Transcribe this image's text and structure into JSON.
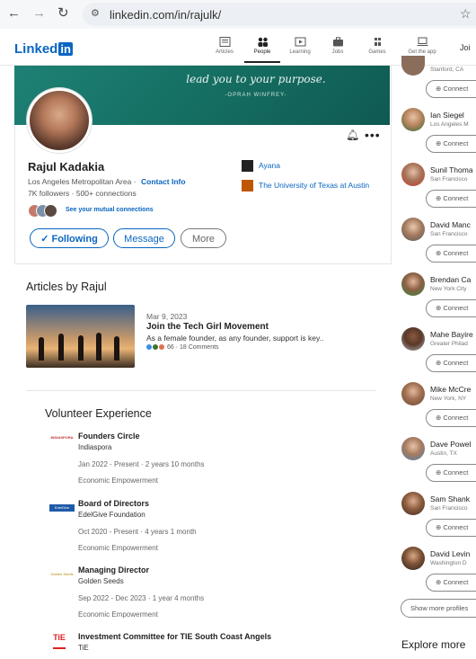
{
  "browser": {
    "url": "linkedin.com/in/rajulk/"
  },
  "nav": {
    "logo": "Linked",
    "logo_box": "in",
    "items": [
      {
        "label": "Articles",
        "icon": "articles-icon"
      },
      {
        "label": "People",
        "icon": "people-icon"
      },
      {
        "label": "Learning",
        "icon": "learning-icon"
      },
      {
        "label": "Jobs",
        "icon": "jobs-icon"
      },
      {
        "label": "Games",
        "icon": "games-icon"
      },
      {
        "label": "Get the app",
        "icon": "get-app-icon"
      }
    ],
    "join": "Joi"
  },
  "profile": {
    "banner_quote": "lead you to your purpose.",
    "banner_author": "-OPRAH WINFREY-",
    "name": "Rajul Kadakia",
    "location": "Los Angeles Metropolitan Area",
    "separator": "·",
    "contact_info": "Contact Info",
    "stats": "7K followers  ·  500+ connections",
    "mutual": "See your mutual connections",
    "follow": "✓ Following",
    "message": "Message",
    "more": "More",
    "experience": [
      {
        "name": "Ayana"
      },
      {
        "name": "The University of Texas at Austin"
      }
    ]
  },
  "articles": {
    "title": "Articles by Rajul",
    "date": "Mar 9, 2023",
    "headline": "Join the Tech Girl Movement",
    "excerpt": "As a female founder, as any founder, support is key..",
    "reactions": "66 · 18 Comments"
  },
  "volunteer": {
    "title": "Volunteer Experience",
    "items": [
      {
        "role": "Founders Circle",
        "org": "Indiaspora",
        "dates": "Jan 2022 - Present · 2 years 10 months",
        "cause": "Economic Empowerment",
        "logo_text": "INDIASPORA"
      },
      {
        "role": "Board of Directors",
        "org": "EdelGive Foundation",
        "dates": "Oct 2020 - Present · 4 years 1 month",
        "cause": "Economic Empowerment",
        "logo_text": "EdelGive"
      },
      {
        "role": "Managing Director",
        "org": "Golden Seeds",
        "dates": "Sep 2022 - Dec 2023 · 1 year 4 months",
        "cause": "Economic Empowerment",
        "logo_text": "Golden Seeds"
      },
      {
        "role": "Investment Committee for TIE South Coast Angels",
        "org": "TiE",
        "dates": "",
        "cause": "",
        "logo_text": "TiE"
      }
    ]
  },
  "sidebar": {
    "top_location": "Stanford, CA",
    "connect_label": "Connect",
    "people": [
      {
        "name": "Ian Siegel",
        "location": "Los Angeles M"
      },
      {
        "name": "Sunil Thoma",
        "location": "San Francisco"
      },
      {
        "name": "David Manc",
        "location": "San Francisco"
      },
      {
        "name": "Brendan Ca",
        "location": "New York City"
      },
      {
        "name": "Mahe Bayire",
        "location": "Greater Philad"
      },
      {
        "name": "Mike McCre",
        "location": "New York, NY"
      },
      {
        "name": "Dave Powel",
        "location": "Austin, TX"
      },
      {
        "name": "Sam Shank",
        "location": "San Francisco"
      },
      {
        "name": "David Levin",
        "location": "Washington D"
      }
    ],
    "show_more": "Show more profiles",
    "explore": "Explore more"
  },
  "colors": {
    "accent": "#0a66c2",
    "banner": "#167064"
  }
}
